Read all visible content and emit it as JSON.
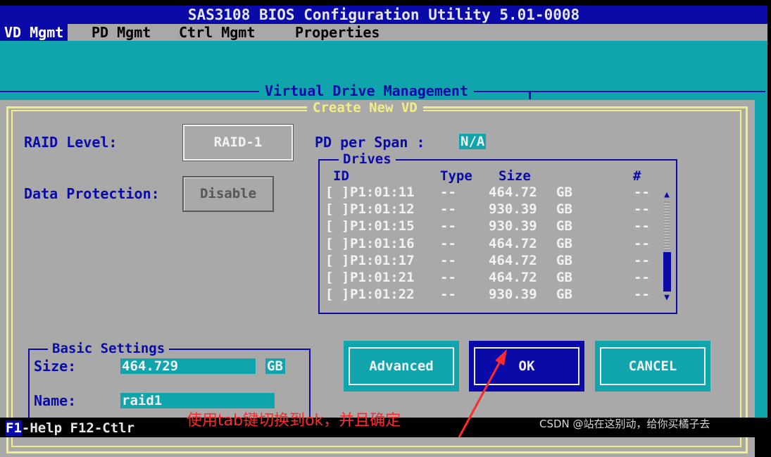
{
  "window": {
    "title": "SAS3108 BIOS Configuration Utility 5.01-0008"
  },
  "menu": [
    "VD Mgmt",
    "PD Mgmt",
    "Ctrl Mgmt",
    "Properties"
  ],
  "screen_title": "Virtual Drive Management",
  "dialog": {
    "title": "Create New VD",
    "raid_level_label": "RAID Level:",
    "raid_level_value": "RAID-1",
    "data_protection_label": "Data Protection:",
    "data_protection_value": "Disable",
    "pd_per_span_label": "PD per Span :",
    "pd_per_span_value": "N/A",
    "drives": {
      "title": "Drives",
      "headers": {
        "id": "ID",
        "type": "Type",
        "size": "Size",
        "hash": "#"
      },
      "rows": [
        {
          "check": "[ ]",
          "id": "P1:01:11",
          "type": "--",
          "size": "464.72",
          "unit": "GB",
          "hash": "--"
        },
        {
          "check": "[ ]",
          "id": "P1:01:12",
          "type": "--",
          "size": "930.39",
          "unit": "GB",
          "hash": "--"
        },
        {
          "check": "[ ]",
          "id": "P1:01:15",
          "type": "--",
          "size": "930.39",
          "unit": "GB",
          "hash": "--"
        },
        {
          "check": "[ ]",
          "id": "P1:01:16",
          "type": "--",
          "size": "464.72",
          "unit": "GB",
          "hash": "--"
        },
        {
          "check": "[ ]",
          "id": "P1:01:17",
          "type": "--",
          "size": "464.72",
          "unit": "GB",
          "hash": "--"
        },
        {
          "check": "[ ]",
          "id": "P1:01:21",
          "type": "--",
          "size": "464.72",
          "unit": "GB",
          "hash": "--"
        },
        {
          "check": "[ ]",
          "id": "P1:01:22",
          "type": "--",
          "size": "930.39",
          "unit": "GB",
          "hash": "--"
        }
      ]
    },
    "basic_settings": {
      "title": "Basic Settings",
      "size_label": "Size:",
      "size_value": "464.729",
      "size_unit": "GB",
      "name_label": "Name:",
      "name_value": "raid1"
    },
    "buttons": {
      "advanced": "Advanced",
      "ok": "OK",
      "cancel": "CANCEL"
    }
  },
  "status_bar": {
    "f1": "F1",
    "help": "-Help F12-Ctlr"
  },
  "annotation": "使用tab键切换到ok，并且确定",
  "watermark": "CSDN @站在这别动，给你买橘子去",
  "colors": {
    "bios_blue": "#0a0aa8",
    "cyan": "#10a4ac",
    "gray": "#a9a9a9",
    "yellow": "#f3ee83",
    "annotation_red": "#ff2a2a"
  }
}
